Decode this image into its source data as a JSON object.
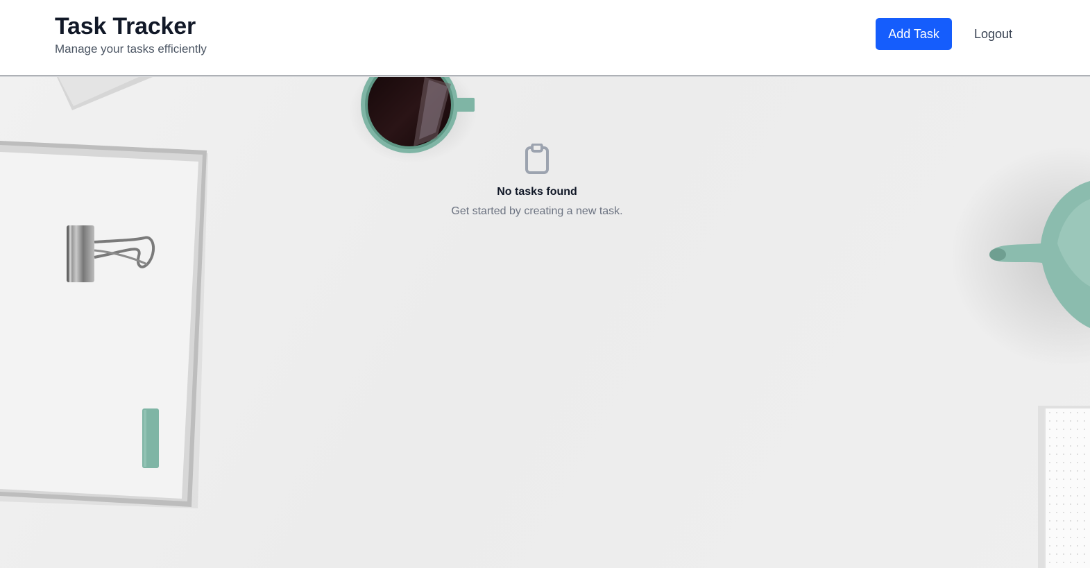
{
  "header": {
    "title": "Task Tracker",
    "subtitle": "Manage your tasks efficiently",
    "add_task_label": "Add Task",
    "logout_label": "Logout"
  },
  "empty_state": {
    "icon": "clipboard-icon",
    "title": "No tasks found",
    "message": "Get started by creating a new task."
  },
  "colors": {
    "primary": "#155dfc",
    "text_dark": "#111827",
    "text_muted": "#6b7280",
    "accent_teal": "#7fb5a5"
  }
}
